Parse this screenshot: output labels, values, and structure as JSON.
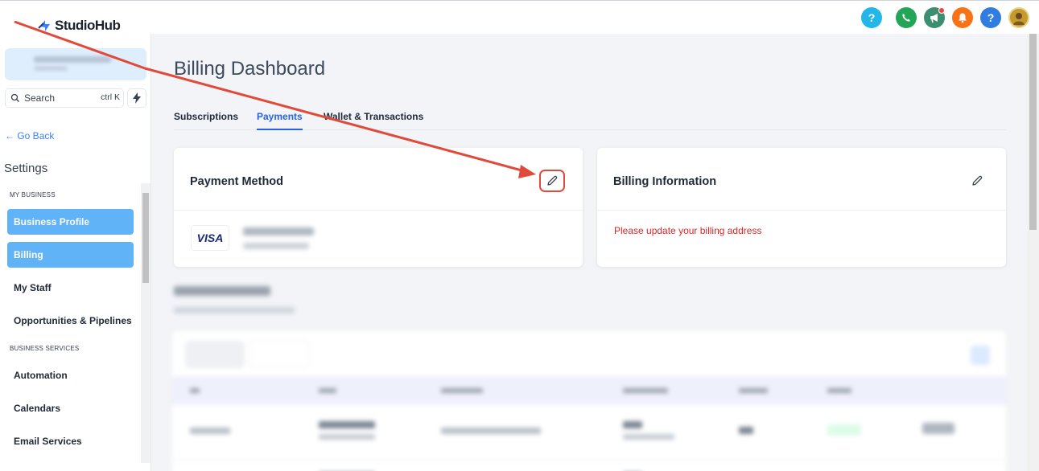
{
  "brand": {
    "name": "StudioHub"
  },
  "top_icons": [
    {
      "icon": "help-icon",
      "glyph": "?",
      "color": "#22b7e8"
    },
    {
      "icon": "phone-icon",
      "glyph": "",
      "color": "#22a556"
    },
    {
      "icon": "megaphone-icon",
      "glyph": "",
      "color": "#3b8f6e"
    },
    {
      "icon": "bell-icon",
      "glyph": "",
      "color": "#f97316"
    },
    {
      "icon": "help-icon",
      "glyph": "?",
      "color": "#2f7de1"
    }
  ],
  "sidebar": {
    "search_label": "Search",
    "search_shortcut": "ctrl K",
    "go_back": "Go Back",
    "settings_title": "Settings",
    "section_my_business": "MY BUSINESS",
    "section_business_services": "BUSINESS SERVICES",
    "items": [
      {
        "label": "Business Profile",
        "active": true
      },
      {
        "label": "Billing",
        "active": true
      },
      {
        "label": "My Staff",
        "active": false
      },
      {
        "label": "Opportunities & Pipelines",
        "active": false
      },
      {
        "label": "Automation",
        "active": false
      },
      {
        "label": "Calendars",
        "active": false
      },
      {
        "label": "Email Services",
        "active": false
      }
    ]
  },
  "main": {
    "title": "Billing Dashboard",
    "tabs": [
      {
        "label": "Subscriptions",
        "active": false
      },
      {
        "label": "Payments",
        "active": true
      },
      {
        "label": "Wallet & Transactions",
        "active": false
      }
    ],
    "payment_card": {
      "title": "Payment Method",
      "card_brand": "VISA"
    },
    "billing_card": {
      "title": "Billing Information",
      "warning": "Please update your billing address"
    }
  },
  "colors": {
    "accent": "#2563eb",
    "sidebar_active": "#60b3f6",
    "warning": "#dc2626",
    "annotation": "#e04a3a"
  }
}
